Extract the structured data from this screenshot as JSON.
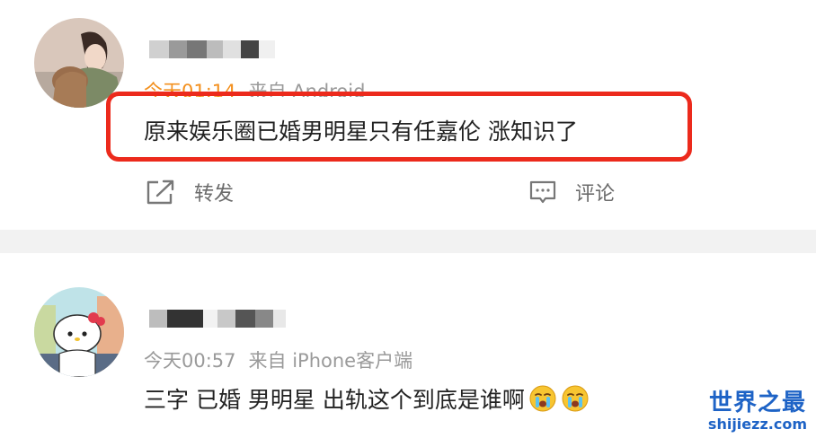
{
  "comments": [
    {
      "time": "今天01:14",
      "source": "来自 Android",
      "text": "原来娱乐圈已婚男明星只有任嘉伦 涨知识了",
      "actions": {
        "repost": "转发",
        "comment": "评论"
      }
    },
    {
      "time": "今天00:57",
      "source": "来自 iPhone客户端",
      "text": "三字 已婚 男明星 出轨这个到底是谁啊"
    }
  ],
  "watermark": {
    "title": "世界之最",
    "url": "shijiezz.com"
  },
  "colors": {
    "time_highlight": "#f3901e",
    "highlight_border": "#ec2a1c",
    "watermark": "#1e63c6"
  },
  "icons": {
    "repost": "share-icon",
    "comment": "comment-icon",
    "emoji": "crying-emoji-icon"
  }
}
